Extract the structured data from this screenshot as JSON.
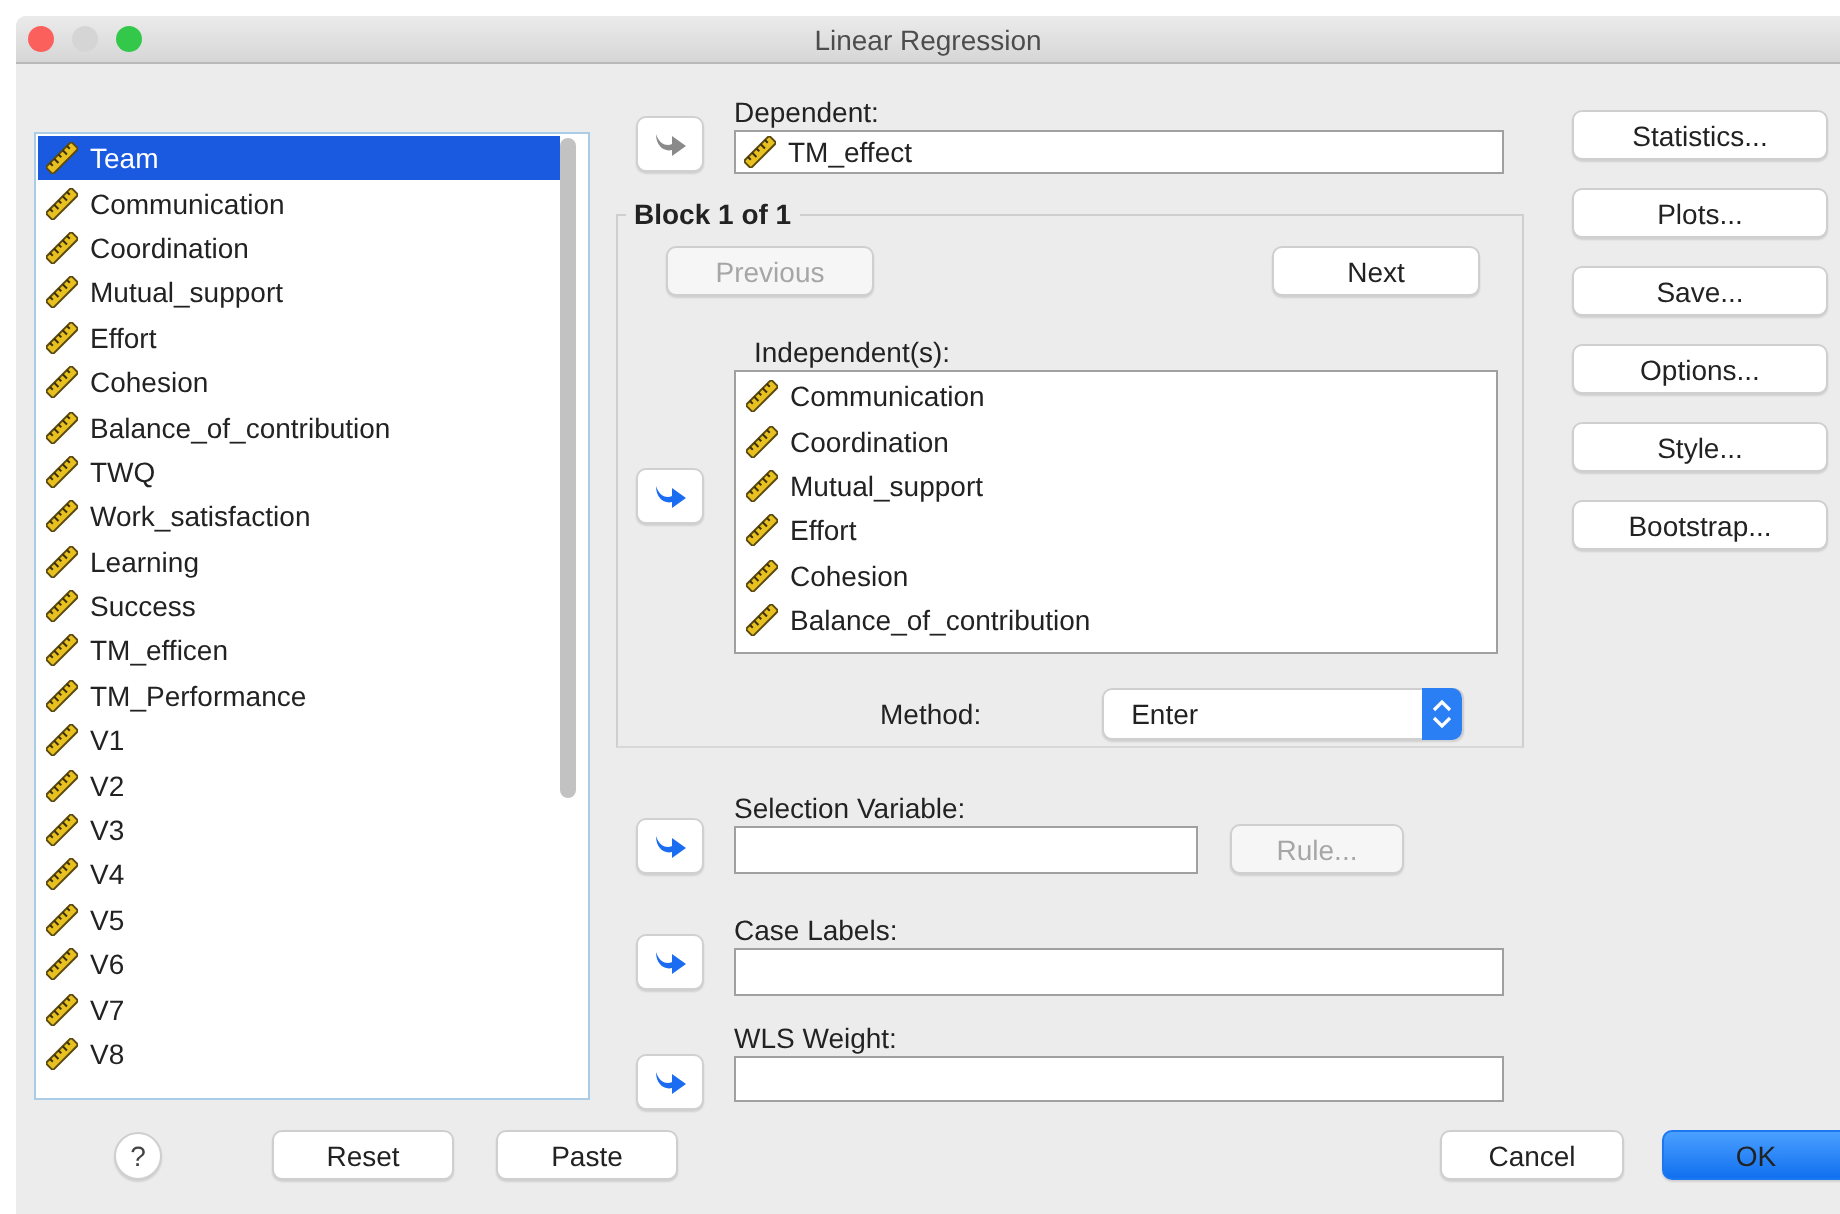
{
  "window": {
    "title": "Linear Regression"
  },
  "variables": [
    {
      "name": "Team",
      "selected": true
    },
    {
      "name": "Communication",
      "selected": false
    },
    {
      "name": "Coordination",
      "selected": false
    },
    {
      "name": "Mutual_support",
      "selected": false
    },
    {
      "name": "Effort",
      "selected": false
    },
    {
      "name": "Cohesion",
      "selected": false
    },
    {
      "name": "Balance_of_contribution",
      "selected": false
    },
    {
      "name": "TWQ",
      "selected": false
    },
    {
      "name": "Work_satisfaction",
      "selected": false
    },
    {
      "name": "Learning",
      "selected": false
    },
    {
      "name": "Success",
      "selected": false
    },
    {
      "name": "TM_efficen",
      "selected": false
    },
    {
      "name": "TM_Performance",
      "selected": false
    },
    {
      "name": "V1",
      "selected": false
    },
    {
      "name": "V2",
      "selected": false
    },
    {
      "name": "V3",
      "selected": false
    },
    {
      "name": "V4",
      "selected": false
    },
    {
      "name": "V5",
      "selected": false
    },
    {
      "name": "V6",
      "selected": false
    },
    {
      "name": "V7",
      "selected": false
    },
    {
      "name": "V8",
      "selected": false
    }
  ],
  "dependent": {
    "label": "Dependent:",
    "arrow_disabled": true,
    "value": "TM_effect"
  },
  "block": {
    "title": "Block 1 of 1",
    "nav_buttons": [
      {
        "label": "Previous",
        "disabled": true
      },
      {
        "label": "Next",
        "disabled": false
      }
    ],
    "independent_label": "Independent(s):",
    "arrow_disabled": false,
    "independents": [
      "Communication",
      "Coordination",
      "Mutual_support",
      "Effort",
      "Cohesion",
      "Balance_of_contribution"
    ],
    "method_label": "Method:",
    "method": "Enter"
  },
  "selection_variable": {
    "label": "Selection Variable:",
    "arrow_disabled": false,
    "rule_button": {
      "label": "Rule...",
      "disabled": true
    }
  },
  "case_labels": {
    "label": "Case Labels:",
    "arrow_disabled": false
  },
  "wls_weight": {
    "label": "WLS Weight:",
    "arrow_disabled": false
  },
  "side_buttons": [
    "Statistics...",
    "Plots...",
    "Save...",
    "Options...",
    "Style...",
    "Bootstrap..."
  ],
  "footer": {
    "help": "?",
    "left_buttons": [
      "Reset",
      "Paste"
    ],
    "right_buttons": [
      {
        "label": "Cancel",
        "default": false
      },
      {
        "label": "OK",
        "default": true
      }
    ]
  }
}
